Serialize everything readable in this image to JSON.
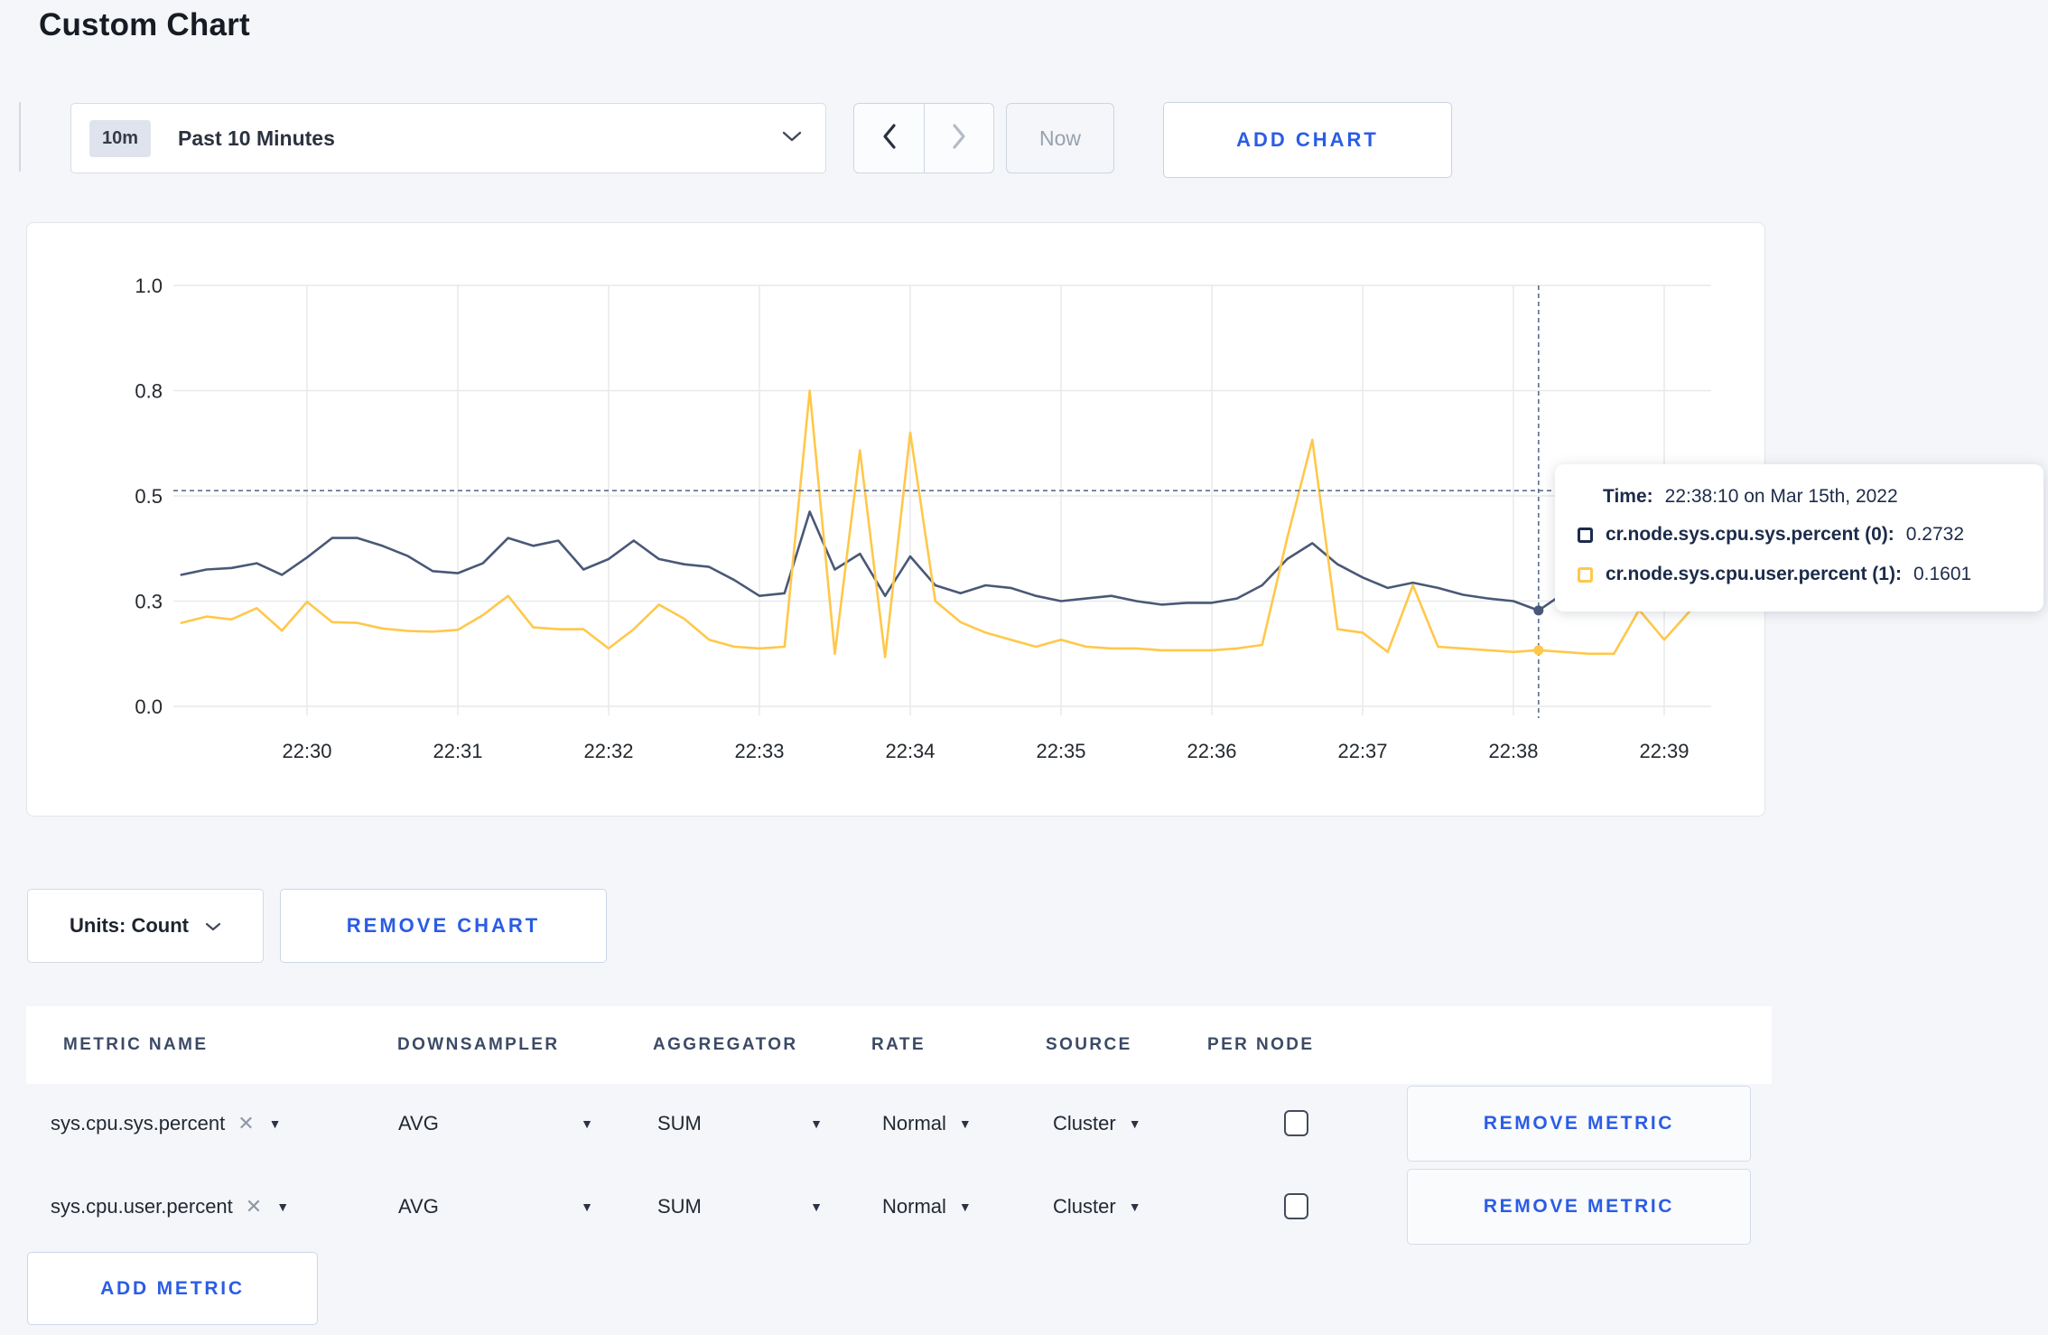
{
  "page": {
    "title": "Custom Chart"
  },
  "toolbar": {
    "time_range_badge": "10m",
    "time_range_label": "Past 10 Minutes",
    "now_label": "Now",
    "add_chart_label": "ADD CHART"
  },
  "chart_data": {
    "type": "line",
    "title": "",
    "xlabel": "",
    "ylabel": "",
    "x_ticks": [
      "22:30",
      "22:31",
      "22:32",
      "22:33",
      "22:34",
      "22:35",
      "22:36",
      "22:37",
      "22:38",
      "22:39"
    ],
    "y_ticks": [
      0,
      0.3,
      0.5,
      0.8,
      1
    ],
    "ylim": [
      0,
      1
    ],
    "grid": true,
    "legend_position": "tooltip",
    "x_step_seconds": 10,
    "x_start_offset_seconds": -50,
    "x_start_time": "22:29:10",
    "axis_color": "#23292f",
    "grid_color": "#e8e9eb",
    "crosshair_color": "#5a6e8c",
    "series": [
      {
        "name": "cr.node.sys.cpu.sys.percent (0)",
        "color": "#4a5877",
        "values": [
          0.35,
          0.36,
          0.363,
          0.372,
          0.35,
          0.383,
          0.42,
          0.42,
          0.405,
          0.386,
          0.357,
          0.353,
          0.372,
          0.42,
          0.405,
          0.415,
          0.36,
          0.38,
          0.415,
          0.38,
          0.37,
          0.365,
          0.34,
          0.31,
          0.315,
          0.47,
          0.36,
          0.39,
          0.31,
          0.385,
          0.33,
          0.315,
          0.33,
          0.325,
          0.31,
          0.3,
          0.305,
          0.31,
          0.3,
          0.29,
          0.295,
          0.295,
          0.305,
          0.33,
          0.38,
          0.41,
          0.37,
          0.345,
          0.325,
          0.335,
          0.325,
          0.312,
          0.305,
          0.3,
          0.2732,
          0.315,
          0.3,
          0.313,
          0.295,
          0.3,
          0.307
        ]
      },
      {
        "name": "cr.node.sys.cpu.user.percent (1)",
        "color": "#ffc84a",
        "values": [
          0.238,
          0.256,
          0.248,
          0.28,
          0.216,
          0.298,
          0.24,
          0.238,
          0.222,
          0.215,
          0.213,
          0.218,
          0.26,
          0.31,
          0.225,
          0.22,
          0.22,
          0.165,
          0.22,
          0.29,
          0.25,
          0.19,
          0.17,
          0.165,
          0.17,
          0.8,
          0.15,
          0.63,
          0.14,
          0.68,
          0.3,
          0.24,
          0.21,
          0.19,
          0.17,
          0.19,
          0.17,
          0.165,
          0.165,
          0.16,
          0.16,
          0.16,
          0.165,
          0.175,
          0.42,
          0.66,
          0.22,
          0.21,
          0.155,
          0.33,
          0.17,
          0.165,
          0.16,
          0.155,
          0.1601,
          0.155,
          0.15,
          0.15,
          0.275,
          0.19,
          0.27
        ]
      }
    ],
    "crosshair": {
      "index": 54,
      "time": "22:38:10",
      "y_value": 0.515
    }
  },
  "tooltip": {
    "time_label": "Time:",
    "time_value": "22:38:10 on Mar 15th, 2022",
    "series": [
      {
        "name": "cr.node.sys.cpu.sys.percent (0):",
        "value": "0.2732",
        "color": "#1c2b4a"
      },
      {
        "name": "cr.node.sys.cpu.user.percent (1):",
        "value": "0.1601",
        "color": "#ffc84a"
      }
    ]
  },
  "chart_controls": {
    "units_label": "Units: Count",
    "remove_chart_label": "REMOVE CHART"
  },
  "metrics_table": {
    "headers": [
      "METRIC NAME",
      "DOWNSAMPLER",
      "AGGREGATOR",
      "RATE",
      "SOURCE",
      "PER NODE"
    ],
    "rows": [
      {
        "metric": "sys.cpu.sys.percent",
        "downsampler": "AVG",
        "aggregator": "SUM",
        "rate": "Normal",
        "source": "Cluster",
        "per_node_checked": false,
        "remove_label": "REMOVE METRIC"
      },
      {
        "metric": "sys.cpu.user.percent",
        "downsampler": "AVG",
        "aggregator": "SUM",
        "rate": "Normal",
        "source": "Cluster",
        "per_node_checked": false,
        "remove_label": "REMOVE METRIC"
      }
    ],
    "add_metric_label": "ADD METRIC"
  },
  "colors": {
    "accent_blue": "#2b5ce5",
    "page_background": "#f4f6f9"
  }
}
